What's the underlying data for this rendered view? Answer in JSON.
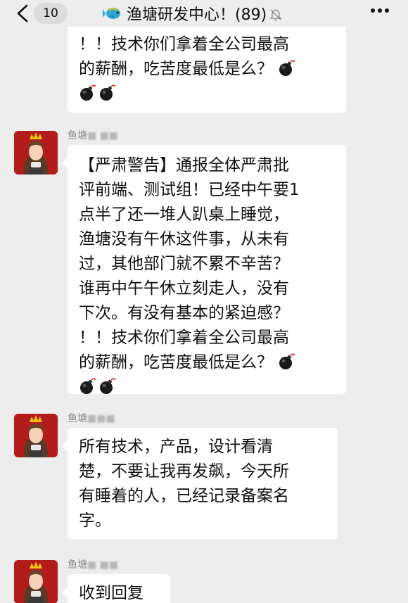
{
  "header": {
    "unread_count": "10",
    "title": "渔塘研发中心！(89)"
  },
  "messages": [
    {
      "lines": [
        "！！技术你们拿着全公司最高",
        "的薪酬，吃苦度最低是么？"
      ]
    },
    {
      "sender": "鱼塘",
      "sender_blurred": "■ ■■",
      "lines": [
        "【严肃警告】通报全体严肃批",
        "评前端、测试组！已经中午要1",
        "点半了还一堆人趴桌上睡觉，",
        "渔塘没有午休这件事，从未有",
        "过，其他部门就不累不辛苦？",
        "谁再中午午休立刻走人，没有",
        "下次。有没有基本的紧迫感？",
        "！！技术你们拿着全公司最高",
        "的薪酬，吃苦度最低是么？"
      ]
    },
    {
      "sender": "鱼塘",
      "sender_blurred": "■■■",
      "lines": [
        "所有技术，产品，设计看清",
        "楚，不要让我再发飙，今天所",
        "有睡着的人，已经记录备案名",
        "字。"
      ]
    },
    {
      "sender": "鱼塘",
      "sender_blurred": "■ ■■",
      "lines": [
        "收到回复"
      ]
    }
  ]
}
